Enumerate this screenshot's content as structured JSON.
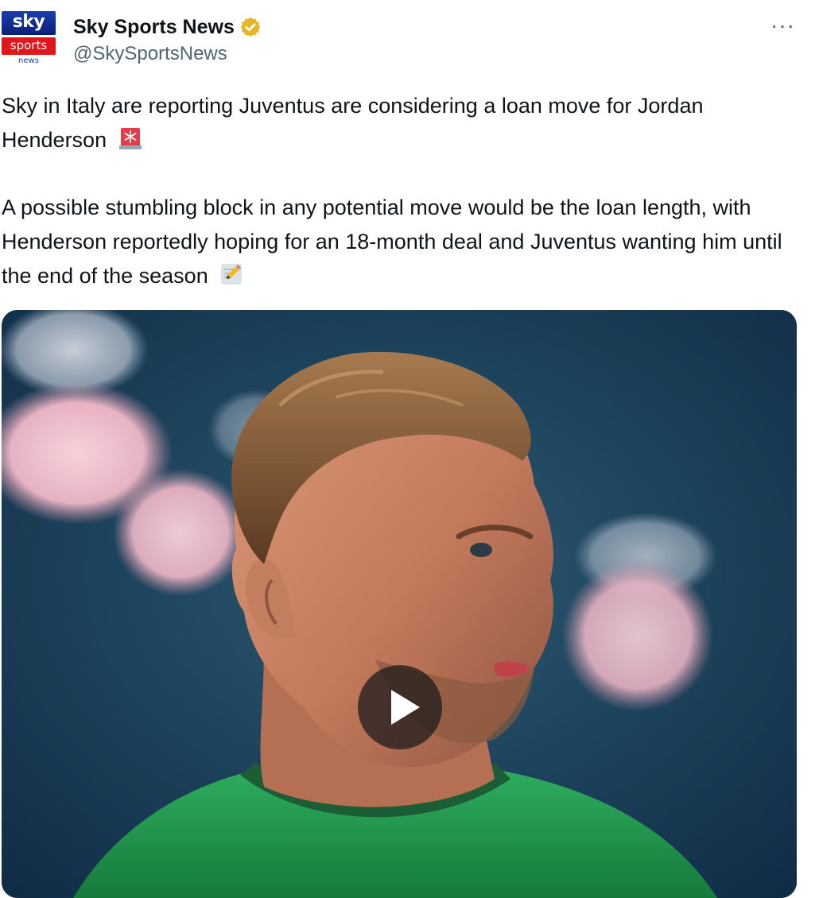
{
  "account": {
    "display_name": "Sky Sports News",
    "handle": "@SkySportsNews",
    "verified_icon": "gold-verified-badge-icon",
    "avatar_logo": {
      "line1": "sky",
      "line2": "sports",
      "line3": "news"
    }
  },
  "more_menu": {
    "label": "···",
    "icon": "more-options-icon"
  },
  "tweet": {
    "paragraph1": "Sky in Italy are reporting Juventus are considering a loan move for Jordan Henderson",
    "paragraph1_emoji": "police-light-emoji",
    "paragraph2": "A possible stumbling block in any potential move would be the loan length, with Henderson reportedly hoping for an 18-month deal and Juventus wanting him until the end of the season",
    "paragraph2_emoji": "memo-pencil-emoji"
  },
  "media": {
    "type": "video",
    "play_icon": "play-icon"
  },
  "colors": {
    "text": "#0f1419",
    "secondary_text": "#536471",
    "verified_gold": "#e8b624",
    "sky_blue": "#1a3fb0",
    "sky_red": "#e0161c",
    "shirt_green": "#1f9a4e"
  }
}
